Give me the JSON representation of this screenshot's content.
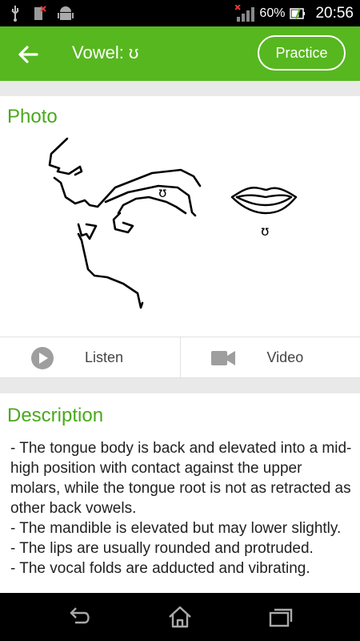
{
  "status_bar": {
    "icons": [
      "usb-icon",
      "sd-card-icon",
      "android-debug-icon",
      "signal-icon",
      "battery-icon"
    ],
    "battery_percent": "60%",
    "time": "20:56"
  },
  "app_bar": {
    "title": "Vowel: ʊ",
    "practice_label": "Practice",
    "color": "#57b71f"
  },
  "photo": {
    "section_title": "Photo",
    "side_label": "ʊ",
    "lips_label": "ʊ"
  },
  "actions": {
    "listen_label": "Listen",
    "video_label": "Video"
  },
  "description": {
    "section_title": "Description",
    "lines": [
      "- The tongue body is back and elevated into a mid-high position with contact against the upper molars, while the tongue root is not as retracted as other back vowels.",
      "- The mandible is elevated but may lower slightly.",
      "- The lips are usually rounded and protruded.",
      "- The vocal folds are adducted and vibrating."
    ]
  },
  "nav_bar": {
    "icons": [
      "back-icon",
      "home-icon",
      "recent-apps-icon"
    ]
  }
}
